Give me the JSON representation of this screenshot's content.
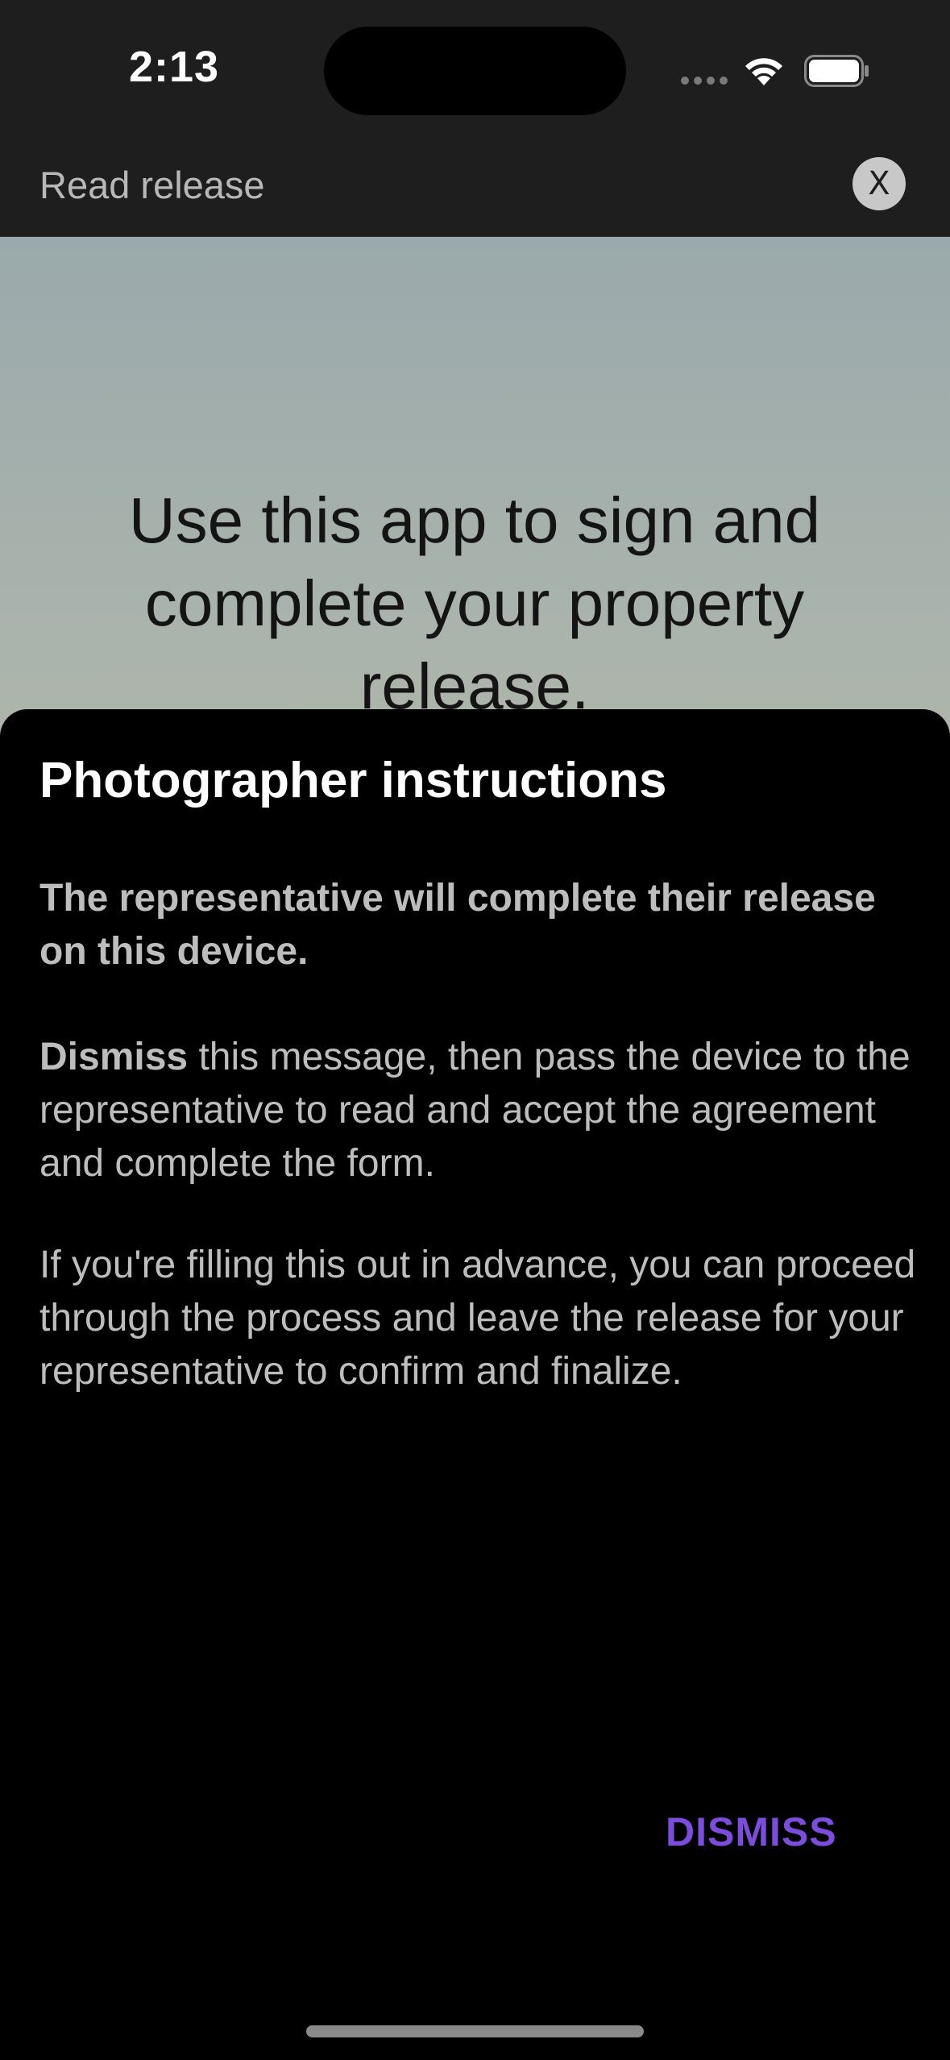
{
  "status_bar": {
    "time": "2:13"
  },
  "header": {
    "title": "Read release",
    "close_label": "X"
  },
  "background": {
    "headline": "Use this app to sign and complete your property release."
  },
  "sheet": {
    "title": "Photographer instructions",
    "paragraph_1": "The representative will complete their release on this device.",
    "paragraph_2_strong": "Dismiss",
    "paragraph_2_rest": " this message, then pass the device to the representative to read and accept the agreement and complete the form.",
    "paragraph_3": "If you're filling this out in advance, you can proceed through the process and leave the release for your representative to confirm and finalize.",
    "dismiss_label": "DISMISS"
  },
  "icons": {
    "cellular": "cellular-signal-icon",
    "wifi": "wifi-icon",
    "battery": "battery-icon",
    "close": "close-icon"
  },
  "colors": {
    "accent": "#7c4ddc",
    "header_bg": "#1e1e1e",
    "sheet_bg": "#000000"
  }
}
